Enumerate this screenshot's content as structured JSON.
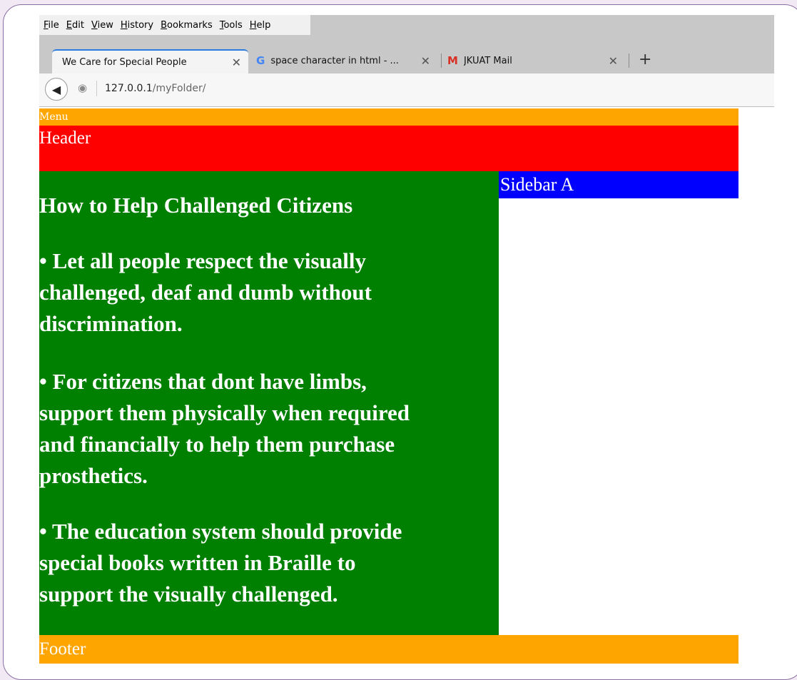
{
  "browser": {
    "menubar": [
      "File",
      "Edit",
      "View",
      "History",
      "Bookmarks",
      "Tools",
      "Help"
    ],
    "tabs": [
      {
        "label": "We Care for Special People",
        "active": true
      },
      {
        "label": "space character in html - ...",
        "active": false,
        "icon": "google-icon"
      },
      {
        "label": "JKUAT Mail",
        "active": false,
        "icon": "gmail-icon"
      }
    ],
    "new_tab_label": "+",
    "url_host": "127.0.0.1",
    "url_path": "/myFolder/"
  },
  "page": {
    "menu": "Menu",
    "header": "Header",
    "main": {
      "heading": "How to Help Challenged Citizens",
      "paragraphs": [
        "• Let all people respect the visually\nchallenged, deaf and   dumb without\ndiscrimination.",
        "• For citizens that dont have limbs,\nsupport them   physically when required\nand financially to help them   purchase\nprosthetics.",
        "• The education system should provide\nspecial books   written in Braille to\nsupport the visually challenged."
      ]
    },
    "sidebar": "Sidebar A",
    "footer": "Footer"
  },
  "colors": {
    "menu": "#ffa500",
    "header": "#ff0000",
    "main": "#008000",
    "sidebar": "#0000ff",
    "footer": "#ffa500"
  }
}
